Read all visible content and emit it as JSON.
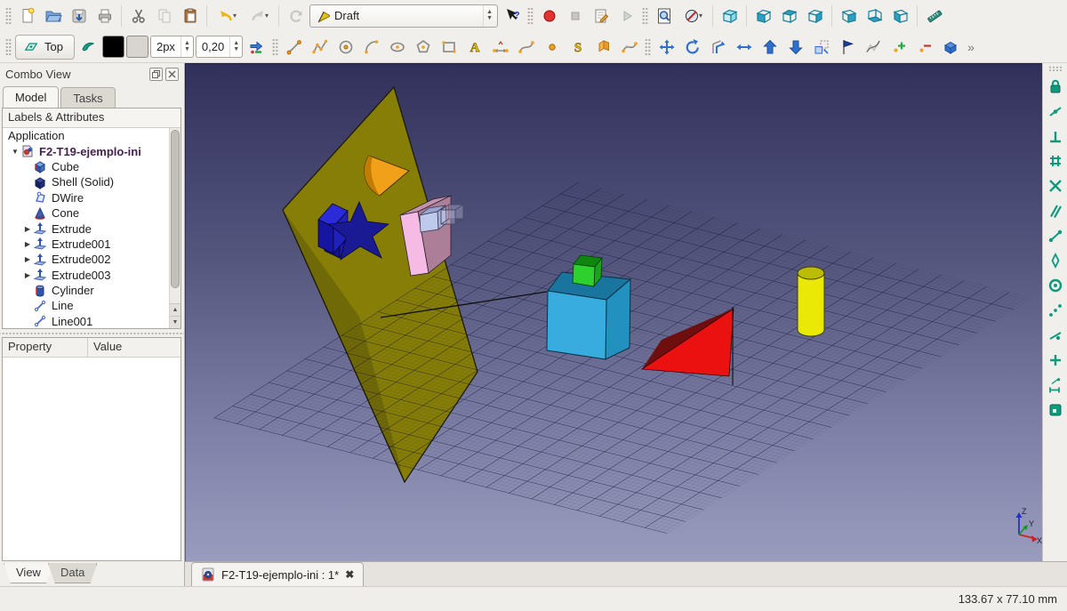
{
  "workbench": {
    "value": "Draft"
  },
  "toolbars": {
    "row1": [
      {
        "t": "grip"
      },
      {
        "t": "btn",
        "name": "new-file-button",
        "icon": "new-file"
      },
      {
        "t": "btn",
        "name": "open-button",
        "icon": "open-folder"
      },
      {
        "t": "btn",
        "name": "save-button",
        "icon": "save"
      },
      {
        "t": "btn",
        "name": "print-button",
        "icon": "print"
      },
      {
        "t": "sep"
      },
      {
        "t": "btn",
        "name": "cut-button",
        "icon": "cut"
      },
      {
        "t": "btn",
        "name": "copy-button",
        "icon": "copy"
      },
      {
        "t": "btn",
        "name": "paste-button",
        "icon": "paste"
      },
      {
        "t": "sep"
      },
      {
        "t": "btn",
        "name": "undo-button",
        "icon": "undo",
        "caret": true
      },
      {
        "t": "btn",
        "name": "redo-button",
        "icon": "redo",
        "caret": true
      },
      {
        "t": "sep"
      },
      {
        "t": "btn",
        "name": "refresh-button",
        "icon": "refresh"
      },
      {
        "t": "combo",
        "name": "workbench-selector",
        "icon": "wb-draft",
        "value": "Draft"
      },
      {
        "t": "btn",
        "name": "whats-this-button",
        "icon": "whats-this"
      },
      {
        "t": "grip"
      },
      {
        "t": "btn",
        "name": "macro-record-button",
        "icon": "record-macro"
      },
      {
        "t": "btn",
        "name": "macro-stop-button",
        "icon": "stop-macro"
      },
      {
        "t": "btn",
        "name": "macro-edit-button",
        "icon": "edit-macro"
      },
      {
        "t": "btn",
        "name": "macro-play-button",
        "icon": "play-macro"
      },
      {
        "t": "grip"
      },
      {
        "t": "btn",
        "name": "fit-all-button",
        "icon": "fit-all"
      },
      {
        "t": "btn",
        "name": "draw-style-button",
        "icon": "draw-style",
        "caret": true
      },
      {
        "t": "sep"
      },
      {
        "t": "btn",
        "name": "view-axonometric-button",
        "icon": "view-axo"
      },
      {
        "t": "sep"
      },
      {
        "t": "btn",
        "name": "view-front-button",
        "icon": "view-front"
      },
      {
        "t": "btn",
        "name": "view-top-button",
        "icon": "view-top"
      },
      {
        "t": "btn",
        "name": "view-right-button",
        "icon": "view-right"
      },
      {
        "t": "sep"
      },
      {
        "t": "btn",
        "name": "view-rear-button",
        "icon": "view-rear"
      },
      {
        "t": "btn",
        "name": "view-bottom-button",
        "icon": "view-bottom"
      },
      {
        "t": "btn",
        "name": "view-left-button",
        "icon": "view-left"
      },
      {
        "t": "sep"
      },
      {
        "t": "btn",
        "name": "measure-button",
        "icon": "measure"
      }
    ],
    "row2": [
      {
        "t": "grip"
      },
      {
        "t": "labeled",
        "name": "working-plane-button",
        "icon": "wp-top",
        "label": "Top"
      },
      {
        "t": "btn",
        "name": "construction-mode-button",
        "icon": "construction"
      },
      {
        "t": "swatch",
        "name": "line-color-swatch",
        "color": "#000000"
      },
      {
        "t": "swatch",
        "name": "face-color-swatch",
        "color": "#d8d5d0"
      },
      {
        "t": "spin",
        "name": "line-width-spin",
        "value": "2px"
      },
      {
        "t": "spin",
        "name": "scale-spin",
        "value": "0,20"
      },
      {
        "t": "btn",
        "name": "apply-style-button",
        "icon": "apply-style"
      },
      {
        "t": "grip"
      },
      {
        "t": "btn",
        "name": "draft-line-button",
        "icon": "draft-line"
      },
      {
        "t": "btn",
        "name": "draft-wire-button",
        "icon": "draft-wire"
      },
      {
        "t": "btn",
        "name": "draft-circle-button",
        "icon": "draft-circle"
      },
      {
        "t": "btn",
        "name": "draft-arc-button",
        "icon": "draft-arc"
      },
      {
        "t": "btn",
        "name": "draft-ellipse-button",
        "icon": "draft-ellipse"
      },
      {
        "t": "btn",
        "name": "draft-polygon-button",
        "icon": "draft-polygon"
      },
      {
        "t": "btn",
        "name": "draft-rectangle-button",
        "icon": "draft-rect"
      },
      {
        "t": "btn",
        "name": "draft-text-button",
        "icon": "draft-text"
      },
      {
        "t": "btn",
        "name": "draft-dimension-button",
        "icon": "draft-dimension"
      },
      {
        "t": "btn",
        "name": "draft-bspline-button",
        "icon": "draft-bspline"
      },
      {
        "t": "btn",
        "name": "draft-point-button",
        "icon": "draft-point"
      },
      {
        "t": "btn",
        "name": "draft-shapestring-button",
        "icon": "draft-shapestring"
      },
      {
        "t": "btn",
        "name": "draft-facebinder-button",
        "icon": "draft-facebinder"
      },
      {
        "t": "btn",
        "name": "draft-bezcurve-button",
        "icon": "draft-bezcurve"
      },
      {
        "t": "grip"
      },
      {
        "t": "btn",
        "name": "draft-move-button",
        "icon": "draft-move"
      },
      {
        "t": "btn",
        "name": "draft-rotate-button",
        "icon": "draft-rotate"
      },
      {
        "t": "btn",
        "name": "draft-offset-button",
        "icon": "draft-offset"
      },
      {
        "t": "btn",
        "name": "draft-trimex-button",
        "icon": "draft-trimex"
      },
      {
        "t": "btn",
        "name": "draft-upgrade-button",
        "icon": "draft-upgrade"
      },
      {
        "t": "btn",
        "name": "draft-downgrade-button",
        "icon": "draft-downgrade"
      },
      {
        "t": "btn",
        "name": "draft-scale-button",
        "icon": "draft-scale"
      },
      {
        "t": "btn",
        "name": "draft-edit-button",
        "icon": "draft-edit"
      },
      {
        "t": "btn",
        "name": "draft-wire2bspline-button",
        "icon": "draft-wire2bspline"
      },
      {
        "t": "btn",
        "name": "draft-addpoint-button",
        "icon": "draft-addpoint"
      },
      {
        "t": "btn",
        "name": "draft-delpoint-button",
        "icon": "draft-delpoint"
      },
      {
        "t": "btn",
        "name": "draft-2sketch-button",
        "icon": "draft-2sketch"
      },
      {
        "t": "overflow",
        "label": "»"
      }
    ],
    "snap": [
      {
        "t": "hgrip"
      },
      {
        "t": "btn",
        "name": "snap-lock-button",
        "icon": "snap-lock"
      },
      {
        "t": "btn",
        "name": "snap-midpoint-button",
        "icon": "snap-midpoint"
      },
      {
        "t": "btn",
        "name": "snap-perpendicular-button",
        "icon": "snap-perpendicular"
      },
      {
        "t": "btn",
        "name": "snap-grid-button",
        "icon": "snap-grid"
      },
      {
        "t": "btn",
        "name": "snap-intersection-button",
        "icon": "snap-intersection"
      },
      {
        "t": "btn",
        "name": "snap-parallel-button",
        "icon": "snap-parallel"
      },
      {
        "t": "btn",
        "name": "snap-endpoint-button",
        "icon": "snap-endpoint"
      },
      {
        "t": "btn",
        "name": "snap-angle-button",
        "icon": "snap-angle"
      },
      {
        "t": "btn",
        "name": "snap-center-button",
        "icon": "snap-center"
      },
      {
        "t": "btn",
        "name": "snap-ortho-button",
        "icon": "snap-ortho"
      },
      {
        "t": "btn",
        "name": "snap-near-button",
        "icon": "snap-near"
      },
      {
        "t": "btn",
        "name": "snap-extension-button",
        "icon": "snap-extension"
      },
      {
        "t": "btn",
        "name": "snap-dimensions-button",
        "icon": "snap-dimensions"
      },
      {
        "t": "btn",
        "name": "snap-workingplane-button",
        "icon": "snap-workingplane"
      }
    ]
  },
  "combo_view": {
    "title": "Combo View",
    "tabs": [
      "Model",
      "Tasks"
    ],
    "active_tab": "Model",
    "tree_header": "Labels & Attributes",
    "root_label": "Application",
    "document_label": "F2-T19-ejemplo-ini",
    "items": [
      {
        "label": "Cube",
        "icon": "tree-cube"
      },
      {
        "label": "Shell (Solid)",
        "icon": "tree-shell"
      },
      {
        "label": "DWire",
        "icon": "tree-wire"
      },
      {
        "label": "Cone",
        "icon": "tree-cone"
      },
      {
        "label": "Extrude",
        "icon": "tree-extrude",
        "expandable": true
      },
      {
        "label": "Extrude001",
        "icon": "tree-extrude",
        "expandable": true
      },
      {
        "label": "Extrude002",
        "icon": "tree-extrude",
        "expandable": true
      },
      {
        "label": "Extrude003",
        "icon": "tree-extrude",
        "expandable": true
      },
      {
        "label": "Cylinder",
        "icon": "tree-cylinder"
      },
      {
        "label": "Line",
        "icon": "tree-line"
      },
      {
        "label": "Line001",
        "icon": "tree-line"
      }
    ]
  },
  "property_panel": {
    "columns": [
      "Property",
      "Value"
    ]
  },
  "bottom_tabs": [
    "View",
    "Data"
  ],
  "mdi": {
    "tab_label": "F2-T19-ejemplo-ini : 1*"
  },
  "status": {
    "dimensions": "133.67 x 77.10 mm"
  },
  "colors": {
    "snap_accent": "#0d9b7d",
    "viewport_top": "#31305b",
    "viewport_bottom": "#9a9cbe",
    "plane_yellow": "#867e06",
    "cube_blue": "#38acdf",
    "cube_green": "#2ed02e",
    "triangle_red": "#ec1111",
    "cylinder_yellow": "#e9e905"
  }
}
